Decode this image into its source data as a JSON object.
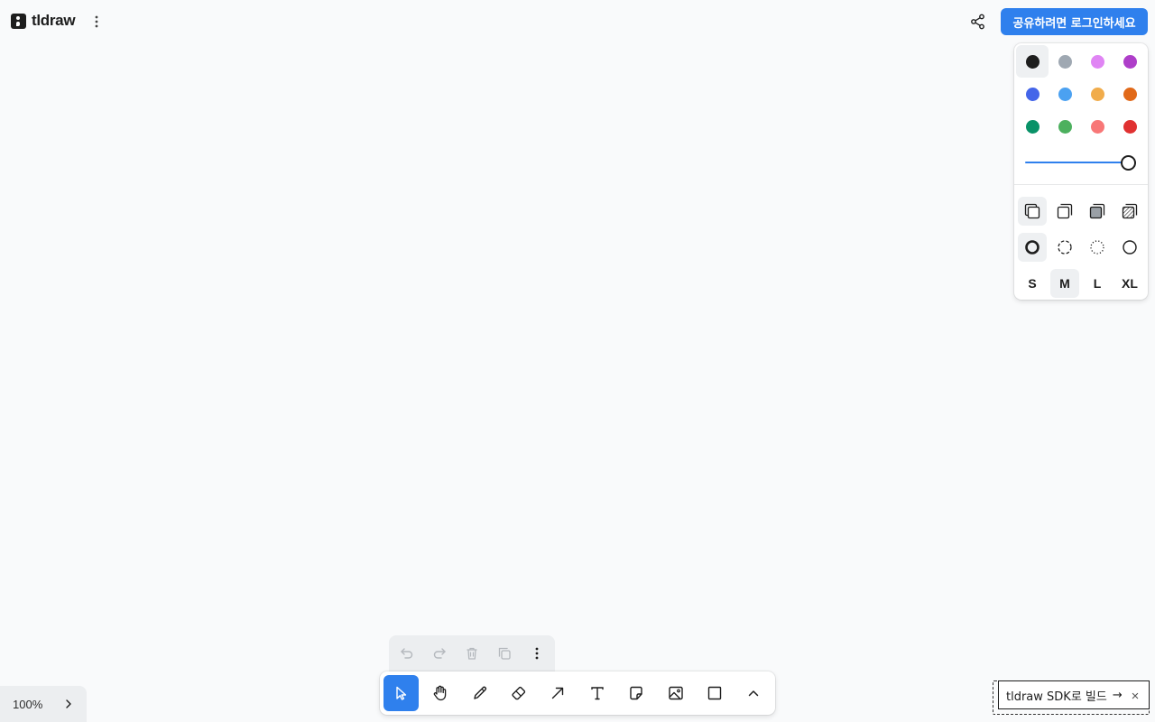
{
  "app": {
    "logo_text": "tldraw"
  },
  "header": {
    "login_label": "공유하려면 로그인하세요"
  },
  "style_panel": {
    "colors": [
      {
        "name": "black",
        "hex": "#1d1d1d",
        "selected": true
      },
      {
        "name": "grey",
        "hex": "#9fa8b2"
      },
      {
        "name": "light-violet",
        "hex": "#e085f4"
      },
      {
        "name": "violet",
        "hex": "#ae3ec9"
      },
      {
        "name": "blue",
        "hex": "#4465e9"
      },
      {
        "name": "light-blue",
        "hex": "#4ba1f1"
      },
      {
        "name": "yellow",
        "hex": "#f1ac4b"
      },
      {
        "name": "orange",
        "hex": "#e16919"
      },
      {
        "name": "green",
        "hex": "#099268"
      },
      {
        "name": "light-green",
        "hex": "#4cb05e"
      },
      {
        "name": "light-red",
        "hex": "#f87777"
      },
      {
        "name": "red",
        "hex": "#e03131"
      }
    ],
    "opacity": 1.0,
    "accent": "#2f80ed",
    "fill_options": [
      "fill-none-icon",
      "fill-semi-icon",
      "fill-solid-icon",
      "fill-pattern-icon"
    ],
    "dash_options": [
      "dash-draw-icon",
      "dash-dashed-icon",
      "dash-dotted-icon",
      "dash-solid-icon"
    ],
    "sizes": [
      {
        "label": "S"
      },
      {
        "label": "M",
        "selected": true
      },
      {
        "label": "L"
      },
      {
        "label": "XL"
      }
    ]
  },
  "actions": [
    "undo-icon",
    "redo-icon",
    "trash-icon",
    "duplicate-icon",
    "more-icon"
  ],
  "toolbar": {
    "tools": [
      "select",
      "hand",
      "draw",
      "eraser",
      "arrow",
      "text",
      "note",
      "image",
      "rectangle",
      "more"
    ],
    "active": "select"
  },
  "zoom": {
    "level": "100%"
  },
  "sdk_badge": {
    "label": "tldraw SDK로 빌드",
    "arrow": "→",
    "close": "×"
  }
}
